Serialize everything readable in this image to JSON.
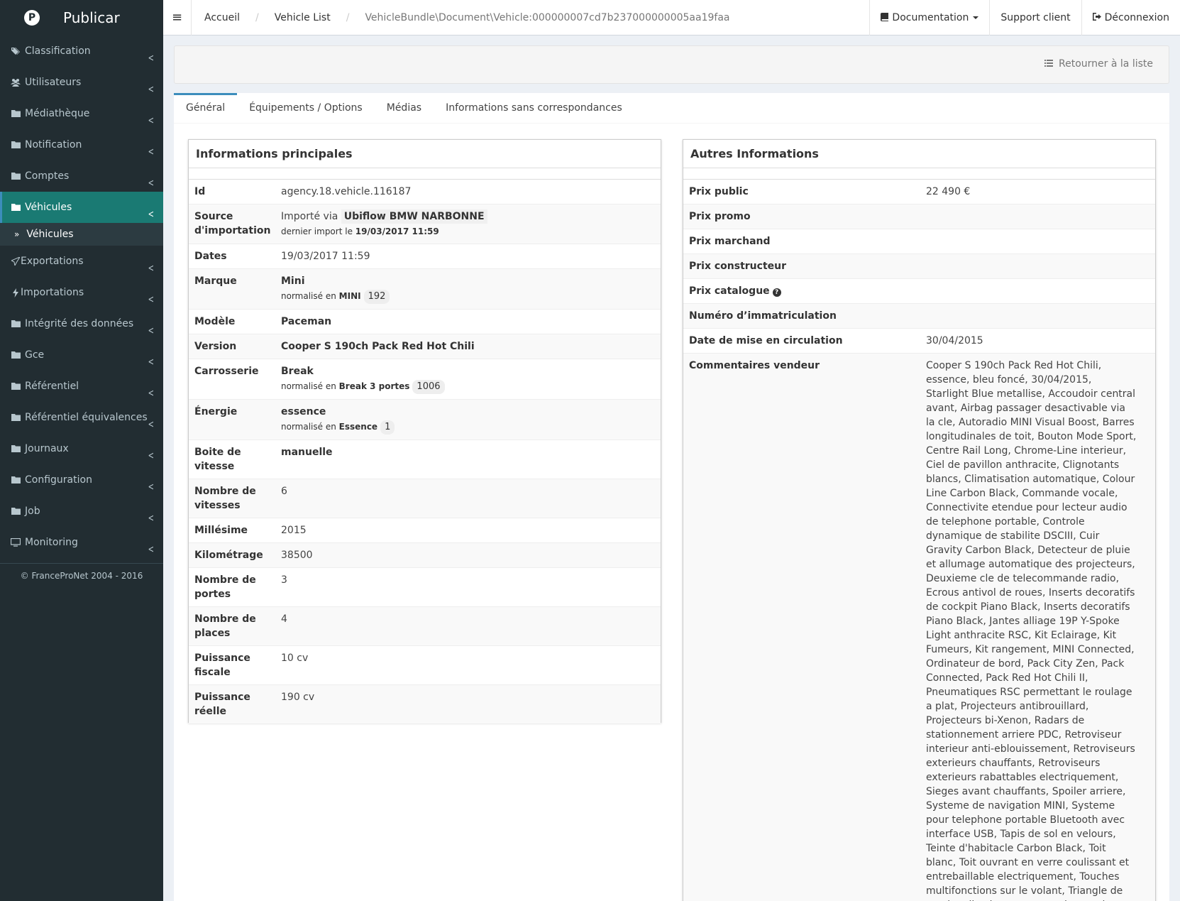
{
  "brand": {
    "logo": "P",
    "name": "Publicar"
  },
  "sidebar": {
    "items": [
      {
        "label": "Classification",
        "icon": "tags-icon"
      },
      {
        "label": "Utilisateurs",
        "icon": "users-icon"
      },
      {
        "label": "Médiathèque",
        "icon": "folder-icon"
      },
      {
        "label": "Notification",
        "icon": "folder-icon"
      },
      {
        "label": "Comptes",
        "icon": "folder-icon"
      },
      {
        "label": "Véhicules",
        "icon": "folder-icon",
        "active": true
      },
      {
        "label": "Exportations",
        "icon": "paper-plane-icon"
      },
      {
        "label": "Importations",
        "icon": "bolt-icon"
      },
      {
        "label": "Intégrité des données",
        "icon": "folder-icon"
      },
      {
        "label": "Gce",
        "icon": "folder-icon"
      },
      {
        "label": "Référentiel",
        "icon": "folder-icon"
      },
      {
        "label": "Référentiel équivalences",
        "icon": "folder-icon"
      },
      {
        "label": "Journaux",
        "icon": "folder-icon"
      },
      {
        "label": "Configuration",
        "icon": "folder-icon"
      },
      {
        "label": "Job",
        "icon": "folder-icon"
      },
      {
        "label": "Monitoring",
        "icon": "desktop-icon"
      }
    ],
    "submenu": {
      "label": "Véhicules"
    },
    "footer": "© FranceProNet 2004 - 2016"
  },
  "breadcrumb": {
    "home": "Accueil",
    "list": "Vehicle List",
    "current": "VehicleBundle\\Document\\Vehicle:000000007cd7b237000000005aa19faa"
  },
  "nav": {
    "documentation": "Documentation",
    "support": "Support client",
    "logout": "Déconnexion"
  },
  "actions": {
    "back": "Retourner à la liste"
  },
  "tabs": [
    "Général",
    "Équipements / Options",
    "Médias",
    "Informations sans correspondances"
  ],
  "main_info": {
    "title": "Informations principales",
    "id_label": "Id",
    "id_value": "agency.18.vehicle.116187",
    "source_label": "Source d'importation",
    "source_prefix": "Importé via",
    "source_value": "Ubiflow BMW NARBONNE",
    "source_sub_prefix": "dernier import le",
    "source_sub_value": "19/03/2017 11:59",
    "dates_label": "Dates",
    "dates_value": "19/03/2017 11:59",
    "marque_label": "Marque",
    "marque_value": "Mini",
    "marque_norm_prefix": "normalisé en",
    "marque_norm": "MINI",
    "marque_badge": "192",
    "modele_label": "Modèle",
    "modele_value": "Paceman",
    "version_label": "Version",
    "version_value": "Cooper S 190ch Pack Red Hot Chili",
    "carrosserie_label": "Carrosserie",
    "carrosserie_value": "Break",
    "carrosserie_norm_prefix": "normalisé en",
    "carrosserie_norm": "Break 3 portes",
    "carrosserie_badge": "1006",
    "energie_label": "Énergie",
    "energie_value": "essence",
    "energie_norm_prefix": "normalisé en",
    "energie_norm": "Essence",
    "energie_badge": "1",
    "boite_label": "Boite de vitesse",
    "boite_value": "manuelle",
    "nb_vitesses_label": "Nombre de vitesses",
    "nb_vitesses_value": "6",
    "millesime_label": "Millésime",
    "millesime_value": "2015",
    "km_label": "Kilométrage",
    "km_value": "38500",
    "portes_label": "Nombre de portes",
    "portes_value": "3",
    "places_label": "Nombre de places",
    "places_value": "4",
    "pfiscale_label": "Puissance fiscale",
    "pfiscale_value": "10 cv",
    "preelle_label": "Puissance réelle",
    "preelle_value": "190 cv"
  },
  "other_info": {
    "title": "Autres Informations",
    "prix_public_label": "Prix public",
    "prix_public_value": "22 490 €",
    "prix_promo_label": "Prix promo",
    "prix_marchand_label": "Prix marchand",
    "prix_constructeur_label": "Prix constructeur",
    "prix_catalogue_label": "Prix catalogue",
    "immat_label": "Numéro d’immatriculation",
    "date_circ_label": "Date de mise en circulation",
    "date_circ_value": "30/04/2015",
    "comments_label": "Commentaires vendeur",
    "comments_value": "Cooper S 190ch Pack Red Hot Chili, essence, bleu foncé, 30/04/2015, Starlight Blue metallise, Accoudoir central avant, Airbag passager desactivable via la cle, Autoradio MINI Visual Boost, Barres longitudinales de toit, Bouton Mode Sport, Centre Rail Long, Chrome-Line interieur, Ciel de pavillon anthracite, Clignotants blancs, Climatisation automatique, Colour Line Carbon Black, Commande vocale, Connectivite etendue pour lecteur audio de telephone portable, Controle dynamique de stabilite DSCIII, Cuir Gravity Carbon Black, Detecteur de pluie et allumage automatique des projecteurs, Deuxieme cle de telecommande radio, Ecrous antivol de roues, Inserts decoratifs de cockpit Piano Black, Inserts decoratifs Piano Black, Jantes alliage 19P Y-Spoke Light anthracite RSC, Kit Eclairage, Kit Fumeurs, Kit rangement, MINI Connected, Ordinateur de bord, Pack City Zen, Pack Connected, Pack Red Hot Chili II, Pneumatiques RSC permettant le roulage a plat, Projecteurs antibrouillard, Projecteurs bi-Xenon, Radars de stationnement arriere PDC, Retroviseur interieur anti-eblouissement, Retroviseurs exterieurs chauffants, Retroviseurs exterieurs rabattables electriquement, Sieges avant chauffants, Spoiler arriere, Systeme de navigation MINI, Systeme pour telephone portable Bluetooth avec interface USB, Tapis de sol en velours, Teinte d'habitacle Carbon Black, Toit blanc, Toit ouvrant en verre coulissant et entrebaillable electriquement, Touches multifonctions sur le volant, Triangle de presignalisation et trousse de premiers secours, Volant Sport gaine cuir"
  },
  "colors": {
    "sidebar": "#222d32",
    "active": "#1a7a73",
    "accent": "#3c8dbc"
  }
}
